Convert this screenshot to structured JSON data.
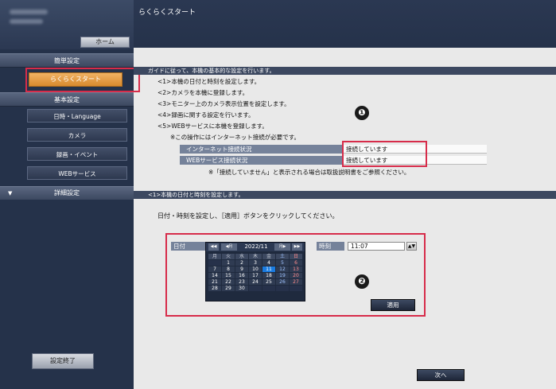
{
  "sidebar": {
    "home_label": "ホーム",
    "easy_setup_label": "簡単設定",
    "quickstart_label": "らくらくスタート",
    "basic_settings_label": "基本設定",
    "items": [
      {
        "label": "日時・Language"
      },
      {
        "label": "カメラ"
      },
      {
        "label": "録画・イベント"
      },
      {
        "label": "WEBサービス"
      }
    ],
    "detail_label": "詳細設定",
    "detail_arrow": "▼",
    "finish_label": "設定終了"
  },
  "header": {
    "title": "らくらくスタート"
  },
  "guide": {
    "section_title": "ガイドに従って、本機の基本的な設定を行います。",
    "lines": [
      "<1>本機の日付と時刻を設定します。",
      "<2>カメラを本機に登録します。",
      "<3>モニター上のカメラ表示位置を設定します。",
      "<4>録画に関する設定を行います。",
      "<5>WEBサービスに本機を登録します。",
      "※この操作にはインターネット接続が必要です。"
    ],
    "status": [
      {
        "label": "インターネット接続状況",
        "value": "接続しています"
      },
      {
        "label": "WEBサービス接続状況",
        "value": "接続しています"
      }
    ],
    "note": "※「接続していません」と表示される場合は取扱説明書をご参照ください。",
    "marker": "❶"
  },
  "step1": {
    "section_title": "<1>本機の日付と時刻を設定します。",
    "instruction": "日付・時刻を設定し、［適用］ボタンをクリックしてください。",
    "date_label": "日付",
    "time_label": "時刻",
    "time_value": "11:07",
    "time_spin": "▲▼",
    "apply_label": "適用",
    "marker": "❷",
    "calendar": {
      "month": "2022/11",
      "prev_year": "◀◀",
      "prev_month": "◀月",
      "next_month": "月▶",
      "next_year": "▶▶",
      "weekdays": [
        "月",
        "火",
        "水",
        "木",
        "金",
        "土",
        "日"
      ],
      "days": [
        "",
        "1",
        "2",
        "3",
        "4",
        "5",
        "6",
        "7",
        "8",
        "9",
        "10",
        "11",
        "12",
        "13",
        "14",
        "15",
        "16",
        "17",
        "18",
        "19",
        "20",
        "21",
        "22",
        "23",
        "24",
        "25",
        "26",
        "27",
        "28",
        "29",
        "30",
        "",
        "",
        "",
        ""
      ],
      "today": "11"
    }
  },
  "footer": {
    "next_label": "次へ"
  },
  "colors": {
    "highlight": "#d72c4a",
    "accent": "#e09a3f",
    "sidebar": "#25324a"
  }
}
